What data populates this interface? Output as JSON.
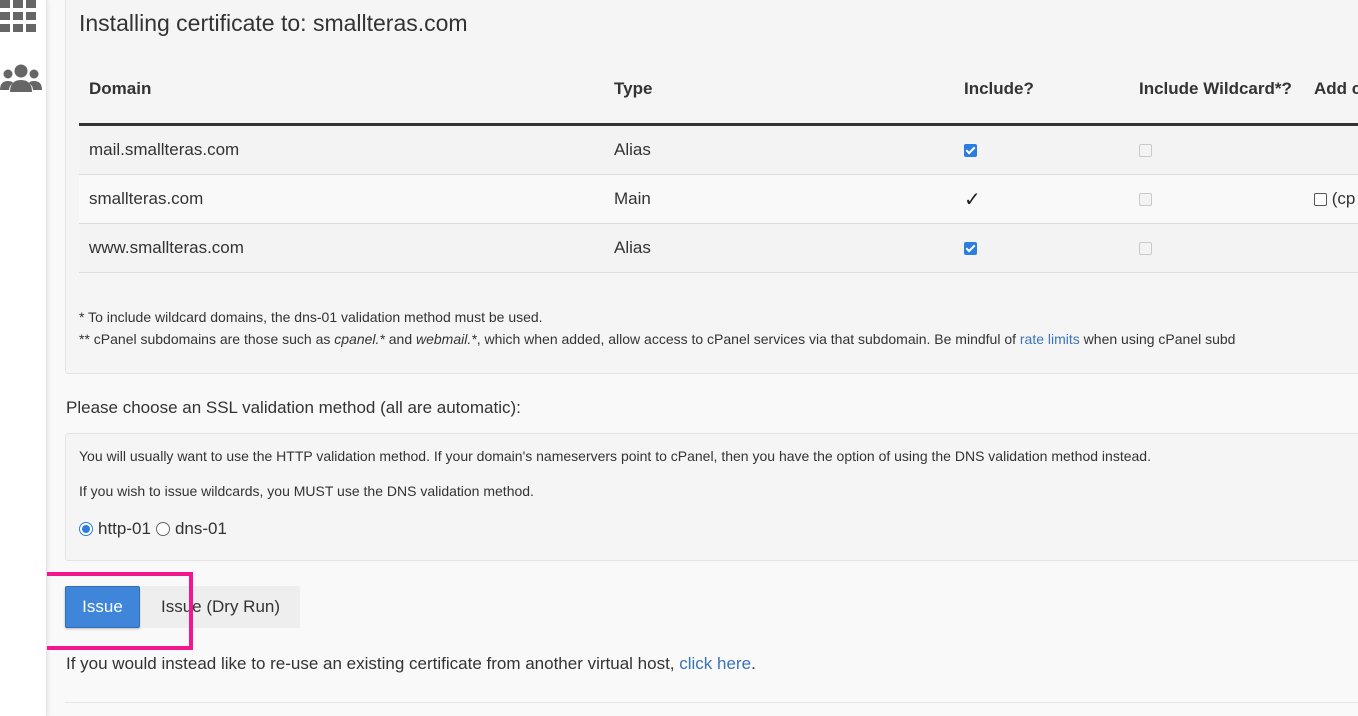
{
  "sidebar": {
    "icons": [
      "grid-icon",
      "users-icon"
    ]
  },
  "certificate_panel": {
    "title": "Installing certificate to: smallteras.com",
    "table": {
      "headers": [
        "Domain",
        "Type",
        "Include?",
        "Include Wildcard*?",
        "Add c"
      ],
      "rows": [
        {
          "domain": "mail.smallteras.com",
          "type": "Alias",
          "include": "checked",
          "wildcard": "disabled",
          "add": ""
        },
        {
          "domain": "smallteras.com",
          "type": "Main",
          "include": "✓",
          "wildcard": "disabled",
          "add": "(cp"
        },
        {
          "domain": "www.smallteras.com",
          "type": "Alias",
          "include": "checked",
          "wildcard": "disabled",
          "add": ""
        }
      ]
    },
    "notes": {
      "line1": "* To include wildcard domains, the dns-01 validation method must be used.",
      "line2_prefix": "** cPanel subdomains are those such as ",
      "line2_em1": "cpanel.*",
      "line2_and": " and ",
      "line2_em2": "webmail.*",
      "line2_mid": ", which when added, allow access to cPanel services via that subdomain. Be mindful of ",
      "line2_link": "rate limits",
      "line2_suffix": " when using cPanel subd"
    }
  },
  "validation": {
    "label": "Please choose an SSL validation method (all are automatic):",
    "info1": "You will usually want to use the HTTP validation method. If your domain's nameservers point to cPanel, then you have the option of using the DNS validation method instead.",
    "info2": "If you wish to issue wildcards, you MUST use the DNS validation method.",
    "options": [
      {
        "label": "http-01",
        "selected": true
      },
      {
        "label": "dns-01",
        "selected": false
      }
    ]
  },
  "actions": {
    "issue_label": "Issue",
    "dry_run_label": "Issue (Dry Run)"
  },
  "footer": {
    "reuse_prefix": "If you would instead like to re-use an existing certificate from another virtual host, ",
    "reuse_link": "click here",
    "reuse_suffix": "."
  },
  "colors": {
    "primary": "#3f85d9",
    "link": "#3a73b8",
    "highlight": "#f2178d",
    "checkbox": "#2b7de0"
  }
}
